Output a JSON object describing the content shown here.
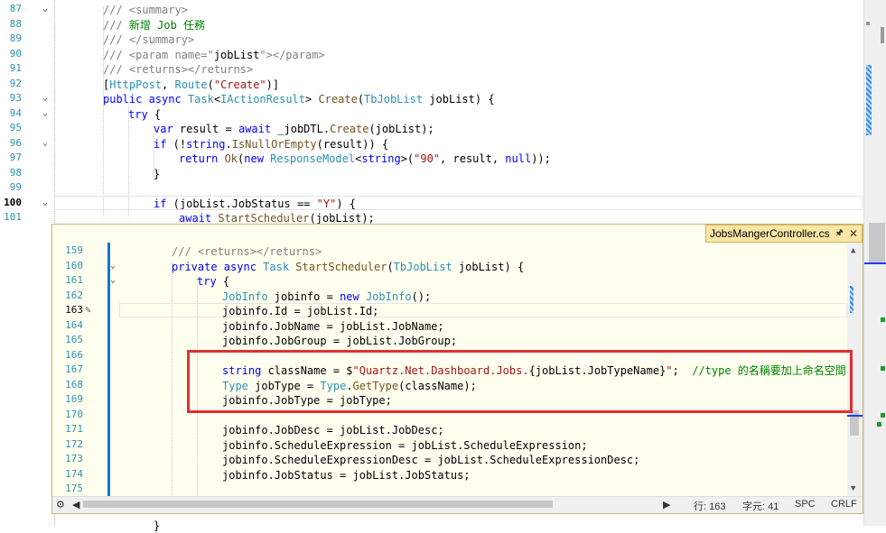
{
  "main_editor": {
    "lines": [
      {
        "num": "87",
        "fold": true,
        "tokens": [
          {
            "t": "/// <summary>",
            "c": "cm"
          }
        ]
      },
      {
        "num": "88",
        "fold": false,
        "tokens": [
          {
            "t": "/// ",
            "c": "cm"
          },
          {
            "t": "新增 Job 任務",
            "c": "cg"
          }
        ]
      },
      {
        "num": "89",
        "fold": false,
        "tokens": [
          {
            "t": "/// </summary>",
            "c": "cm"
          }
        ]
      },
      {
        "num": "90",
        "fold": false,
        "tokens": [
          {
            "t": "/// <param name=\"",
            "c": "cm"
          },
          {
            "t": "jobList",
            "c": "pl"
          },
          {
            "t": "\"></param>",
            "c": "cm"
          }
        ]
      },
      {
        "num": "91",
        "fold": false,
        "tokens": [
          {
            "t": "/// <returns></returns>",
            "c": "cm"
          }
        ]
      },
      {
        "num": "92",
        "fold": false,
        "tokens": [
          {
            "t": "[",
            "c": "pl"
          },
          {
            "t": "HttpPost",
            "c": "ty"
          },
          {
            "t": ", ",
            "c": "pl"
          },
          {
            "t": "Route",
            "c": "ty"
          },
          {
            "t": "(",
            "c": "pl"
          },
          {
            "t": "\"Create\"",
            "c": "st"
          },
          {
            "t": ")]",
            "c": "pl"
          }
        ]
      },
      {
        "num": "93",
        "fold": true,
        "tokens": [
          {
            "t": "public ",
            "c": "kw"
          },
          {
            "t": "async ",
            "c": "kw"
          },
          {
            "t": "Task",
            "c": "ty"
          },
          {
            "t": "<",
            "c": "pl"
          },
          {
            "t": "IActionResult",
            "c": "ty"
          },
          {
            "t": "> ",
            "c": "pl"
          },
          {
            "t": "Create",
            "c": "mt"
          },
          {
            "t": "(",
            "c": "pl"
          },
          {
            "t": "TbJobList",
            "c": "ty"
          },
          {
            "t": " jobList) {",
            "c": "pl"
          }
        ]
      },
      {
        "num": "94",
        "fold": true,
        "tokens": [
          {
            "t": "try",
            "c": "kw"
          },
          {
            "t": " {",
            "c": "pl"
          }
        ]
      },
      {
        "num": "95",
        "fold": false,
        "tokens": [
          {
            "t": "var ",
            "c": "kw"
          },
          {
            "t": "result = ",
            "c": "pl"
          },
          {
            "t": "await",
            "c": "kw"
          },
          {
            "t": " _jobDTL.",
            "c": "pl"
          },
          {
            "t": "Create",
            "c": "mt"
          },
          {
            "t": "(jobList);",
            "c": "pl"
          }
        ]
      },
      {
        "num": "96",
        "fold": true,
        "tokens": [
          {
            "t": "if",
            "c": "kw"
          },
          {
            "t": " (!",
            "c": "pl"
          },
          {
            "t": "string",
            "c": "kw"
          },
          {
            "t": ".",
            "c": "pl"
          },
          {
            "t": "IsNullOrEmpty",
            "c": "mt"
          },
          {
            "t": "(result)) {",
            "c": "pl"
          }
        ]
      },
      {
        "num": "97",
        "fold": false,
        "tokens": [
          {
            "t": "return ",
            "c": "kw"
          },
          {
            "t": "Ok",
            "c": "mt"
          },
          {
            "t": "(",
            "c": "pl"
          },
          {
            "t": "new ",
            "c": "kw"
          },
          {
            "t": "ResponseModel",
            "c": "ty"
          },
          {
            "t": "<",
            "c": "pl"
          },
          {
            "t": "string",
            "c": "kw"
          },
          {
            "t": ">(",
            "c": "pl"
          },
          {
            "t": "\"90\"",
            "c": "st"
          },
          {
            "t": ", result, ",
            "c": "pl"
          },
          {
            "t": "null",
            "c": "kw"
          },
          {
            "t": "));",
            "c": "pl"
          }
        ]
      },
      {
        "num": "98",
        "fold": false,
        "tokens": [
          {
            "t": "}",
            "c": "pl"
          }
        ]
      },
      {
        "num": "99",
        "fold": false,
        "tokens": []
      },
      {
        "num": "100",
        "fold": true,
        "current": true,
        "tokens": [
          {
            "t": "if",
            "c": "kw"
          },
          {
            "t": " (jobList.JobStatus == ",
            "c": "pl"
          },
          {
            "t": "\"Y\"",
            "c": "st"
          },
          {
            "t": ") {",
            "c": "pl"
          }
        ]
      },
      {
        "num": "101",
        "fold": false,
        "tokens": [
          {
            "t": "await",
            "c": "kw"
          },
          {
            "t": " ",
            "c": "pl"
          },
          {
            "t": "StartScheduler",
            "c": "mt"
          },
          {
            "t": "(jobList);",
            "c": "pl"
          }
        ]
      }
    ],
    "bottom_line": {
      "text": "}"
    }
  },
  "peek": {
    "filename": "JobsMangerController.cs",
    "lines": [
      {
        "num": "159",
        "fold": false,
        "tokens": [
          {
            "t": "/// <returns></returns>",
            "c": "cm"
          }
        ]
      },
      {
        "num": "160",
        "fold": true,
        "tokens": [
          {
            "t": "private ",
            "c": "kw"
          },
          {
            "t": "async ",
            "c": "kw"
          },
          {
            "t": "Task ",
            "c": "ty"
          },
          {
            "t": "StartScheduler",
            "c": "mt"
          },
          {
            "t": "(",
            "c": "pl"
          },
          {
            "t": "TbJobList",
            "c": "ty"
          },
          {
            "t": " jobList) {",
            "c": "pl"
          }
        ]
      },
      {
        "num": "161",
        "fold": true,
        "tokens": [
          {
            "t": "try",
            "c": "kw"
          },
          {
            "t": " {",
            "c": "pl"
          }
        ]
      },
      {
        "num": "162",
        "fold": false,
        "tokens": [
          {
            "t": "JobInfo",
            "c": "ty"
          },
          {
            "t": " jobinfo = ",
            "c": "pl"
          },
          {
            "t": "new ",
            "c": "kw"
          },
          {
            "t": "JobInfo",
            "c": "ty"
          },
          {
            "t": "();",
            "c": "pl"
          }
        ]
      },
      {
        "num": "163",
        "fold": false,
        "current": true,
        "tokens": [
          {
            "t": "jobinfo.Id = jobList.Id;",
            "c": "pl"
          }
        ]
      },
      {
        "num": "164",
        "fold": false,
        "tokens": [
          {
            "t": "jobinfo.JobName = jobList.JobName;",
            "c": "pl"
          }
        ]
      },
      {
        "num": "165",
        "fold": false,
        "tokens": [
          {
            "t": "jobinfo.JobGroup = jobList.JobGroup;",
            "c": "pl"
          }
        ]
      },
      {
        "num": "166",
        "fold": false,
        "tokens": []
      },
      {
        "num": "167",
        "fold": false,
        "tokens": [
          {
            "t": "string ",
            "c": "kw"
          },
          {
            "t": "className = $",
            "c": "pl"
          },
          {
            "t": "\"Quartz.Net.Dashboard.Jobs.",
            "c": "st"
          },
          {
            "t": "{jobList.JobTypeName}",
            "c": "pl"
          },
          {
            "t": "\"",
            "c": "st"
          },
          {
            "t": ";  ",
            "c": "pl"
          },
          {
            "t": "//type 的名稱要加上命名空間",
            "c": "cg"
          }
        ]
      },
      {
        "num": "168",
        "fold": false,
        "tokens": [
          {
            "t": "Type",
            "c": "ty"
          },
          {
            "t": " jobType = ",
            "c": "pl"
          },
          {
            "t": "Type",
            "c": "ty"
          },
          {
            "t": ".",
            "c": "pl"
          },
          {
            "t": "GetType",
            "c": "mt"
          },
          {
            "t": "(className);",
            "c": "pl"
          }
        ]
      },
      {
        "num": "169",
        "fold": false,
        "tokens": [
          {
            "t": "jobinfo.JobType = jobType;",
            "c": "pl"
          }
        ]
      },
      {
        "num": "170",
        "fold": false,
        "tokens": []
      },
      {
        "num": "171",
        "fold": false,
        "tokens": [
          {
            "t": "jobinfo.JobDesc = jobList.JobDesc;",
            "c": "pl"
          }
        ]
      },
      {
        "num": "172",
        "fold": false,
        "tokens": [
          {
            "t": "jobinfo.ScheduleExpression = jobList.ScheduleExpression;",
            "c": "pl"
          }
        ]
      },
      {
        "num": "173",
        "fold": false,
        "tokens": [
          {
            "t": "jobinfo.ScheduleExpressionDesc = jobList.ScheduleExpressionDesc;",
            "c": "pl"
          }
        ]
      },
      {
        "num": "174",
        "fold": false,
        "tokens": [
          {
            "t": "jobinfo.JobStatus = jobList.JobStatus;",
            "c": "pl"
          }
        ]
      },
      {
        "num": "175",
        "fold": false,
        "tokens": []
      }
    ],
    "status": {
      "line": "行: 163",
      "char": "字元: 41",
      "spc": "SPC",
      "crlf": "CRLF"
    }
  },
  "colors": {
    "highlight_box": "#e03030",
    "peek_background": "#fffff0",
    "peek_tab": "#fbe6a6"
  }
}
